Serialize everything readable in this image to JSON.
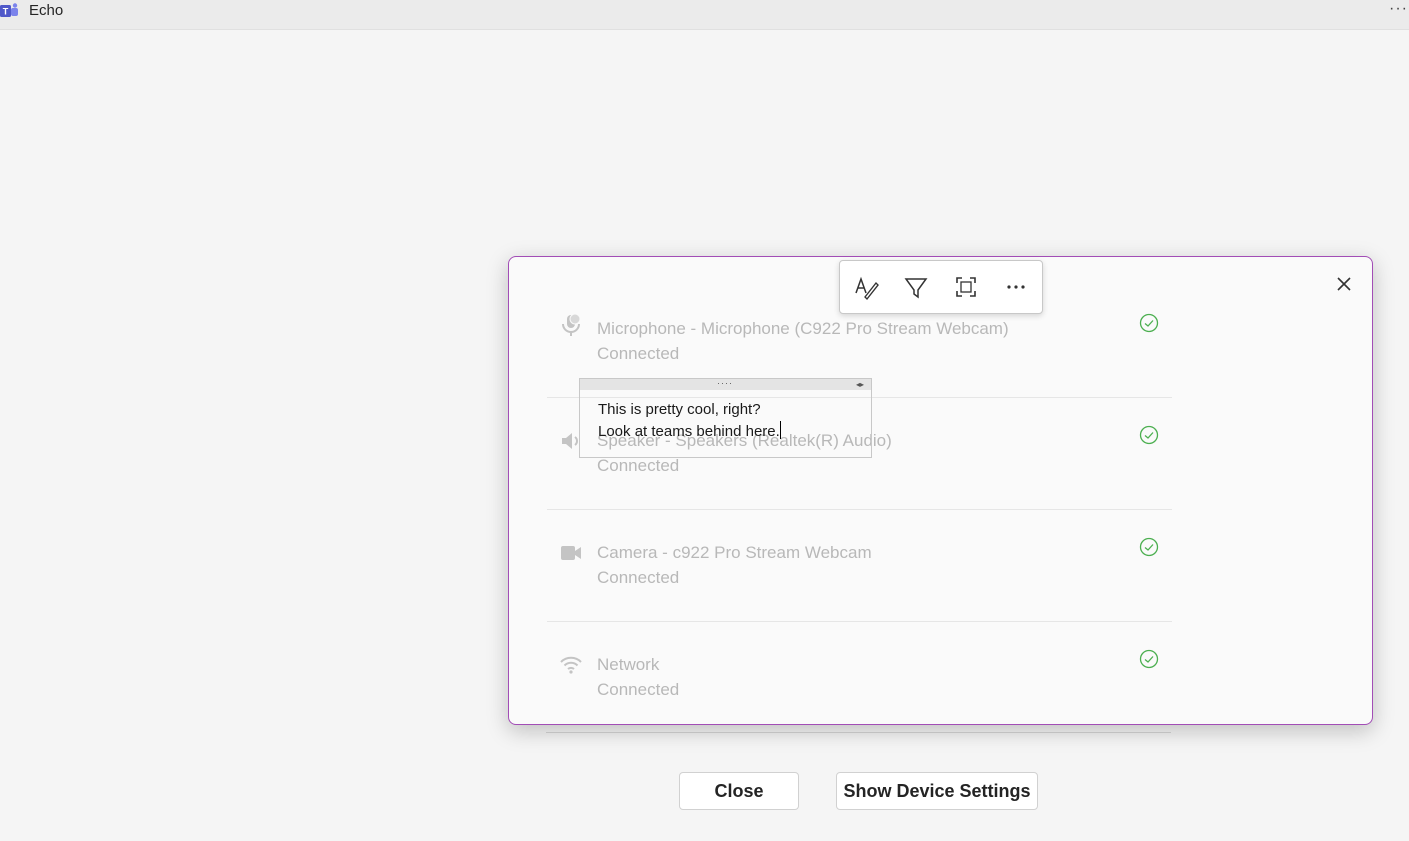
{
  "app": {
    "title": "Echo",
    "more_label": "···"
  },
  "devices": [
    {
      "name": "Microphone - Microphone (C922 Pro Stream Webcam)",
      "status": "Connected",
      "icon": "microphone-icon"
    },
    {
      "name": "Speaker - Speakers (Realtek(R) Audio)",
      "status": "Connected",
      "icon": "speaker-icon"
    },
    {
      "name": "Camera - c922 Pro Stream Webcam",
      "status": "Connected",
      "icon": "camera-icon"
    },
    {
      "name": "Network",
      "status": "Connected",
      "icon": "wifi-icon"
    }
  ],
  "buttons": {
    "close_label": "Close",
    "settings_label": "Show Device Settings"
  },
  "ink_toolbar": {
    "tools": [
      "pen-icon",
      "highlighter-icon",
      "screen-capture-icon",
      "more-icon"
    ],
    "more_label": "···"
  },
  "note": {
    "grip_label": "····",
    "resize_label": "◂▸",
    "line1": "This is pretty cool, right?",
    "line2": "Look at teams behind here."
  },
  "colors": {
    "overlay_border": "#a24db6",
    "check": "#4caf50",
    "muted_text": "#b8b8b8"
  }
}
